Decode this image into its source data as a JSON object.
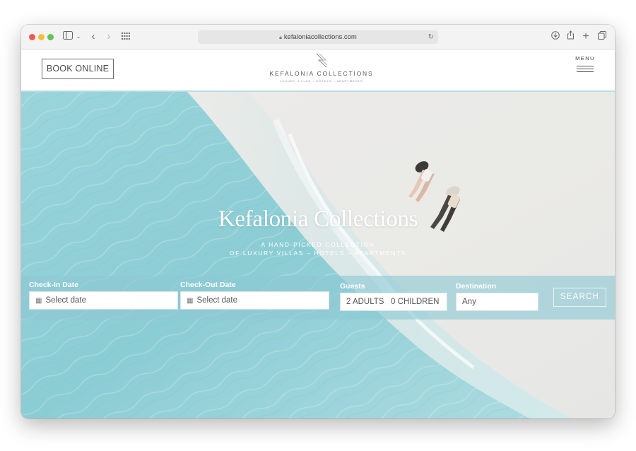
{
  "browser": {
    "url": "kefaloniacollections.com",
    "icons": [
      "sidebar-icon",
      "chevron-down-icon",
      "back-icon",
      "forward-icon",
      "grid-icon",
      "lock-icon",
      "reload-icon",
      "download-icon",
      "share-icon",
      "new-tab-icon",
      "tabs-overview-icon"
    ]
  },
  "header": {
    "book_label": "BOOK ONLINE",
    "logo_name": "KEFALONIA COLLECTIONS",
    "logo_tagline": "LUXURY VILLAS – HOTELS – APARTMENTS",
    "menu_label": "MENU"
  },
  "hero": {
    "title": "Kefalonia Collections",
    "subtitle_line1": "A HAND-PICKED COLLECTION",
    "subtitle_line2": "OF LUXURY VILLAS – HOTELS – APARTMENTS"
  },
  "booking": {
    "checkin_label": "Check-In Date",
    "checkin_placeholder": "Select date",
    "checkout_label": "Check-Out Date",
    "checkout_placeholder": "Select date",
    "guests_label": "Guests",
    "guests_value": "2 ADULTS   0 CHILDREN",
    "destination_label": "Destination",
    "destination_value": "Any",
    "search_label": "SEARCH"
  },
  "colors": {
    "sea": "#7fc6cf",
    "sand": "#e9e9e6",
    "booking_bar": "#8cc8d4",
    "header_rule": "#b9dce3"
  }
}
